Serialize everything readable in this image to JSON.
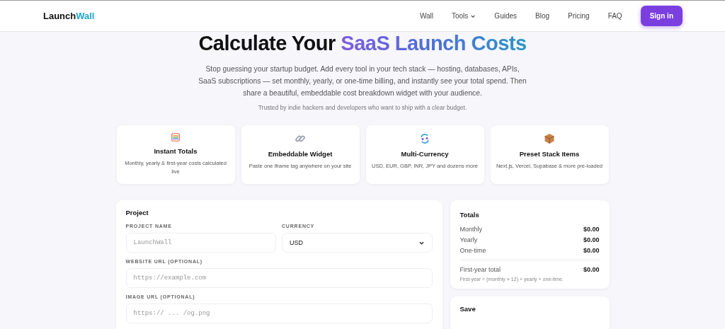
{
  "nav": {
    "logo_main": "Launch",
    "logo_accent": "Wall",
    "links": [
      {
        "label": "Wall",
        "dropdown": false
      },
      {
        "label": "Tools",
        "dropdown": true
      },
      {
        "label": "Guides",
        "dropdown": false
      },
      {
        "label": "Blog",
        "dropdown": false
      },
      {
        "label": "Pricing",
        "dropdown": false
      },
      {
        "label": "FAQ",
        "dropdown": false
      }
    ],
    "cta": "Sign in"
  },
  "hero": {
    "title": "Calculate Your",
    "title_highlight": "SaaS Launch Costs",
    "description": "Stop guessing your startup budget. Add every tool in your tech stack — hosting, databases, APIs, SaaS subscriptions — set monthly, yearly, or one-time billing, and instantly see your total spend. Then share a beautiful, embeddable cost breakdown widget with your audience.",
    "trust": "Trusted by indie hackers and developers who want to ship with a clear budget."
  },
  "features": [
    {
      "kind": "sheet",
      "title": "Instant Totals",
      "text": "Monthly, yearly & first-year costs calculated live"
    },
    {
      "kind": "link",
      "title": "Embeddable Widget",
      "text": "Paste one iframe tag anywhere on your site"
    },
    {
      "kind": "exchange",
      "title": "Multi-Currency",
      "text": "USD, EUR, GBP, INR, JPY and dozens more"
    },
    {
      "kind": "package",
      "title": "Preset Stack Items",
      "text": "Next.js, Vercel, Supabase & more pre-loaded"
    }
  ],
  "project": {
    "title": "Project",
    "name_label": "PROJECT NAME",
    "name_placeholder": "LaunchWall",
    "currency_label": "CURRENCY",
    "currency_value": "USD",
    "website_label": "WEBSITE URL (OPTIONAL)",
    "website_placeholder": "https://example.com",
    "image_label": "IMAGE URL (OPTIONAL)",
    "image_placeholder": "https:// ... /og.png"
  },
  "totals": {
    "title": "Totals",
    "rows": [
      {
        "label": "Monthly",
        "value": "$0.00"
      },
      {
        "label": "Yearly",
        "value": "$0.00"
      },
      {
        "label": "One-time",
        "value": "$0.00"
      }
    ],
    "first_year_label": "First-year total",
    "first_year_value": "$0.00",
    "note": "First-year = (monthly × 12) + yearly + one-time."
  },
  "save": {
    "title": "Save"
  }
}
